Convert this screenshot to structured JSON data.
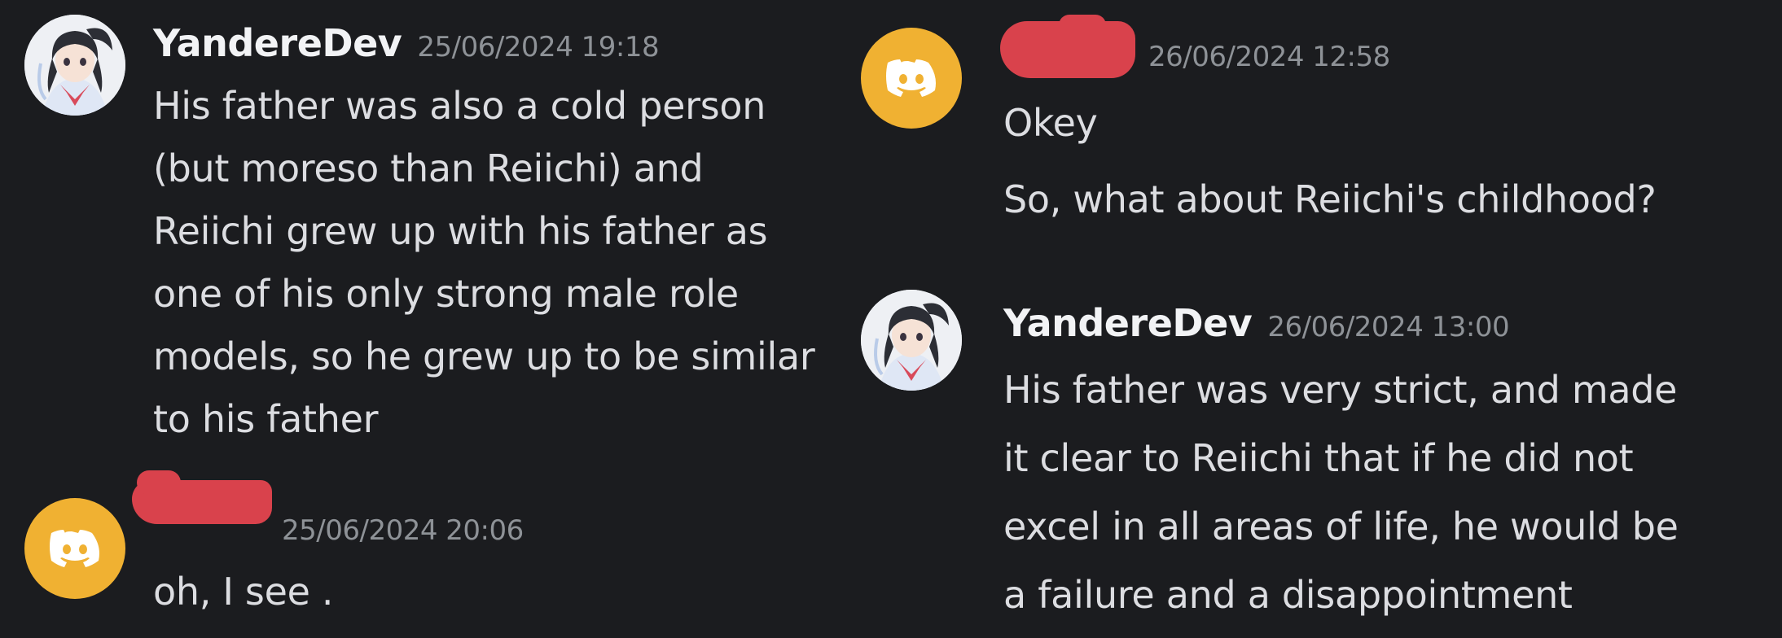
{
  "messages": [
    {
      "author": "YandereDev",
      "timestamp": "25/06/2024 19:18",
      "lines": [
        "His father was also a cold person",
        "(but moreso than Reiichi) and",
        "Reiichi grew up with his father as",
        "one of his only strong male role",
        "models, so he grew up to be similar",
        "to his father"
      ]
    },
    {
      "author": "",
      "author_redacted": true,
      "timestamp": "25/06/2024 20:06",
      "lines": [
        "oh, I see ."
      ]
    },
    {
      "author": "",
      "author_redacted": true,
      "timestamp": "26/06/2024 12:58",
      "lines": [
        "Okey",
        "So, what about Reiichi's childhood?"
      ]
    },
    {
      "author": "YandereDev",
      "timestamp": "26/06/2024 13:00",
      "lines": [
        "His father was very strict, and made",
        "it clear to Reiichi that if he did not",
        "excel in all areas of life, he would be",
        "a failure and a disappointment"
      ]
    }
  ],
  "colors": {
    "background": "#1b1c1f",
    "discord_avatar": "#f0b132",
    "redaction": "#d9424c",
    "username": "#f2f3f5",
    "timestamp": "#8e9297",
    "message_text": "#dcdde1"
  },
  "icons": {
    "discord_default_avatar": "discord-logo-icon",
    "anime_avatar": "anime-girl-avatar"
  }
}
